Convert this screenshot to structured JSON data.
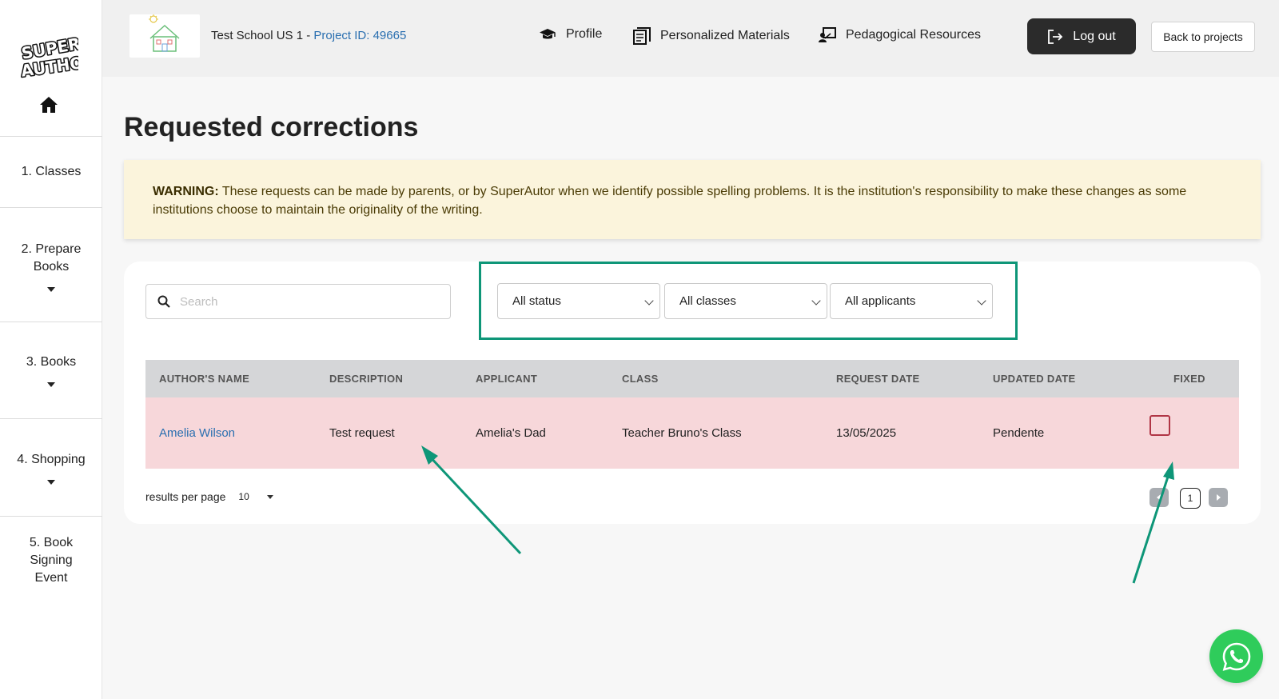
{
  "sidebar": {
    "items": [
      {
        "label": "1. Classes"
      },
      {
        "label": "2. Prepare Books"
      },
      {
        "label": "3. Books"
      },
      {
        "label": "4. Shopping"
      },
      {
        "label": "5. Book Signing Event"
      }
    ]
  },
  "header": {
    "school_name": "Test School US 1 - ",
    "project_id": "Project ID: 49665",
    "nav": [
      {
        "label": "Profile",
        "icon": "graduation-cap-icon"
      },
      {
        "label": "Personalized Materials",
        "icon": "books-icon"
      },
      {
        "label": "Pedagogical Resources",
        "icon": "presentation-icon"
      }
    ],
    "logout_label": "Log out",
    "back_label": "Back to projects"
  },
  "page": {
    "title": "Requested corrections",
    "warning_strong": "WARNING:",
    "warning_text": " These requests can be made by parents, or by SuperAutor when we identify possible spelling problems. It is the institution's responsibility to make these changes as some institutions choose to maintain the originality of the writing."
  },
  "search": {
    "placeholder": "Search"
  },
  "filters": {
    "status": "All status",
    "classes": "All classes",
    "applicants": "All applicants"
  },
  "table": {
    "columns": [
      "AUTHOR'S NAME",
      "DESCRIPTION",
      "APPLICANT",
      "CLASS",
      "REQUEST DATE",
      "UPDATED DATE",
      "FIXED"
    ],
    "rows": [
      {
        "author": "Amelia Wilson",
        "description": "Test request",
        "applicant": "Amelia's Dad",
        "class": "Teacher Bruno's Class",
        "request_date": "13/05/2025",
        "updated_date": "Pendente",
        "fixed": false
      }
    ]
  },
  "pagination": {
    "results_per_page_label": "results per page",
    "results_per_page_value": "10",
    "current_page": "1"
  },
  "colors": {
    "accent": "#0e9678",
    "row_highlight": "#f7d7da",
    "warning_bg": "#fbf4dc",
    "link": "#2a6fb0",
    "whatsapp": "#2fcc5b"
  }
}
